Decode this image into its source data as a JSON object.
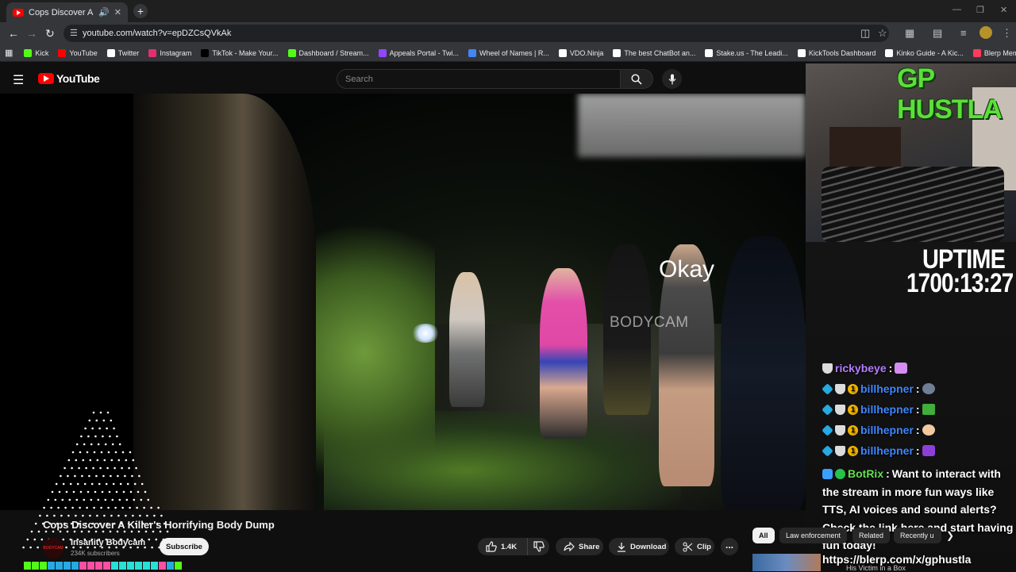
{
  "browser": {
    "tab_title": "Cops Discover A Killer's Ho",
    "url": "youtube.com/watch?v=epDZCsQVkAk",
    "new_tab": "+",
    "bookmarks": [
      {
        "label": "Kick",
        "color": "#53fc18"
      },
      {
        "label": "YouTube",
        "color": "#ff0000"
      },
      {
        "label": "Twitter",
        "color": "#ffffff"
      },
      {
        "label": "Instagram",
        "color": "#e1306c"
      },
      {
        "label": "TikTok - Make Your...",
        "color": "#000000"
      },
      {
        "label": "Dashboard / Stream...",
        "color": "#53fc18"
      },
      {
        "label": "Appeals Portal - Twi...",
        "color": "#9146ff"
      },
      {
        "label": "Wheel of Names | R...",
        "color": "#4285f4"
      },
      {
        "label": "VDO.Ninja",
        "color": "#ffffff"
      },
      {
        "label": "The best ChatBot an...",
        "color": "#ffffff"
      },
      {
        "label": "Stake.us - The Leadi...",
        "color": "#ffffff"
      },
      {
        "label": "KickTools Dashboard",
        "color": "#ffffff"
      },
      {
        "label": "Kinko Guide - A Kic...",
        "color": "#ffffff"
      },
      {
        "label": "Blerp Memes | Best...",
        "color": "#ff3b5c"
      }
    ]
  },
  "youtube": {
    "logo_text": "YouTube",
    "search_placeholder": "Search",
    "video": {
      "caption": "Okay",
      "watermark": "BODYCAM"
    },
    "title": "Cops Discover A Killer's Horrifying Body Dump",
    "channel": {
      "name": "Insanity Bodycam",
      "subscribers": "234K subscribers",
      "avatar_text": "BODYCAM"
    },
    "subscribe_label": "Subscribe",
    "actions": {
      "likes": "1.4K",
      "share": "Share",
      "download": "Download",
      "clip": "Clip",
      "more": "..."
    },
    "chips": [
      "All",
      "Law enforcement",
      "Related",
      "Recently u"
    ],
    "recommended_title": "His Victim in a Box"
  },
  "stream_overlay": {
    "streamer": "GP HUSTLA",
    "uptime_label": "UPTIME",
    "uptime_value": "1700:13:27",
    "chat": [
      {
        "user": "rickybeye",
        "color": "#b57cff"
      },
      {
        "user": "billhepner",
        "color": "#3d86ff"
      },
      {
        "user": "billhepner",
        "color": "#3d86ff"
      },
      {
        "user": "billhepner",
        "color": "#3d86ff"
      },
      {
        "user": "billhepner",
        "color": "#3d86ff"
      }
    ],
    "bot": {
      "user": "BotRix",
      "message": "Want to interact with the stream in more fun ways like TTS, AI voices and sound alerts? Check the link here and start having fun today!",
      "link": "https://blerp.com/x/gphustla"
    }
  }
}
